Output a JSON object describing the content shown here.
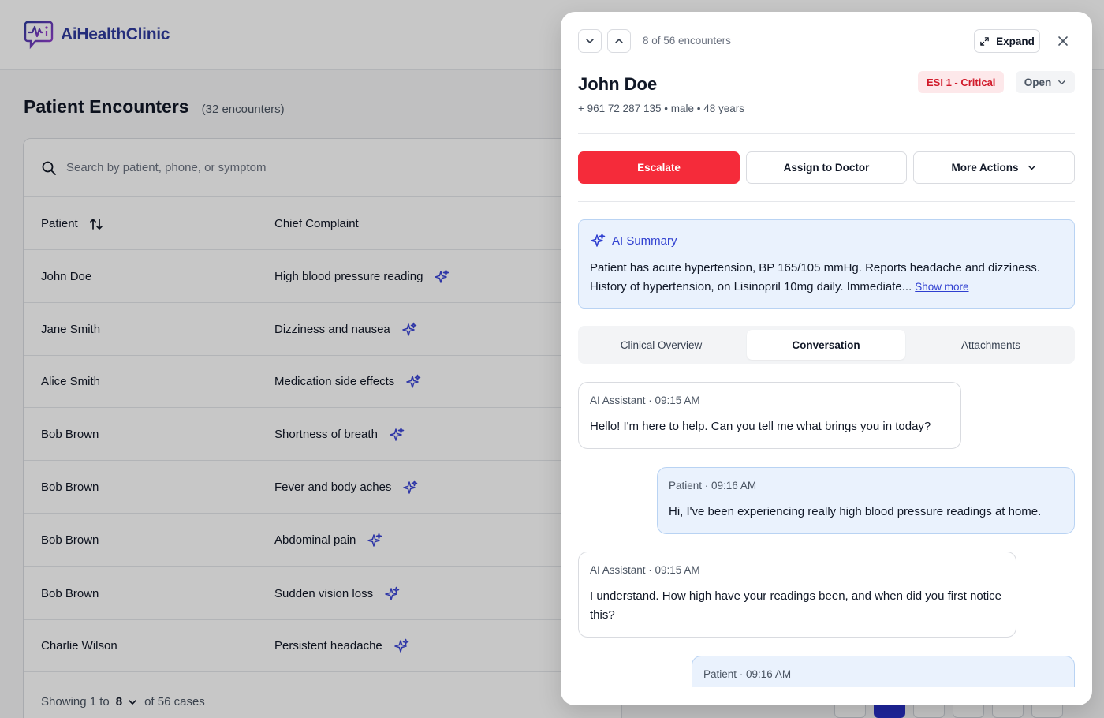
{
  "brand": {
    "name": "AiHealthClinic",
    "accent": "#2f3a9e",
    "logo_icon": "chat-heartbeat-icon"
  },
  "page": {
    "title": "Patient Encounters",
    "count_label": "(32 encounters)"
  },
  "search": {
    "placeholder": "Search by patient, phone, or symptom",
    "value": ""
  },
  "table": {
    "columns": {
      "patient": "Patient",
      "complaint": "Chief Complaint"
    },
    "rows": [
      {
        "patient": "John Doe",
        "complaint": "High blood pressure reading"
      },
      {
        "patient": "Jane Smith",
        "complaint": "Dizziness and nausea"
      },
      {
        "patient": "Alice Smith",
        "complaint": "Medication side effects"
      },
      {
        "patient": "Bob Brown",
        "complaint": "Shortness of breath"
      },
      {
        "patient": "Bob Brown",
        "complaint": "Fever and body aches"
      },
      {
        "patient": "Bob Brown",
        "complaint": "Abdominal pain"
      },
      {
        "patient": "Bob Brown",
        "complaint": "Sudden vision loss"
      },
      {
        "patient": "Charlie Wilson",
        "complaint": "Persistent headache"
      }
    ],
    "footer": {
      "showing_prefix": "Showing 1 to",
      "per_page": "8",
      "of_total": "of 56 cases"
    }
  },
  "drawer": {
    "nav_label": "8 of 56 encounters",
    "expand_label": "Expand",
    "patient": {
      "name": "John Doe",
      "meta": "+ 961 72 287 135 • male • 48 years"
    },
    "esi_badge": "ESI 1 - Critical",
    "status": "Open",
    "actions": {
      "escalate": "Escalate",
      "assign": "Assign to Doctor",
      "more": "More Actions"
    },
    "ai_summary": {
      "title": "AI Summary",
      "text": "Patient has acute hypertension, BP 165/105 mmHg. Reports headache and dizziness. History of hypertension, on Lisinopril 10mg daily. Immediate...",
      "show_more": "Show more"
    },
    "tabs": [
      "Clinical Overview",
      "Conversation",
      "Attachments"
    ],
    "active_tab": "Conversation",
    "messages": [
      {
        "sender": "AI Assistant · 09:15 AM",
        "text": "Hello! I'm here to help. Can you tell me what brings you in today?"
      },
      {
        "sender": "Patient · 09:16 AM",
        "text": "Hi, I've been experiencing really high blood pressure readings at home."
      },
      {
        "sender": "AI Assistant · 09:15 AM",
        "text": "I understand. How high have your readings been, and when did you first notice this?"
      },
      {
        "sender": "Patient · 09:16 AM",
        "text": ""
      }
    ]
  },
  "colors": {
    "danger": "#f52b3a",
    "esi_bg": "#fde8ea",
    "ai_bg": "#eaf2fd",
    "ai_accent": "#2f3fd0"
  }
}
